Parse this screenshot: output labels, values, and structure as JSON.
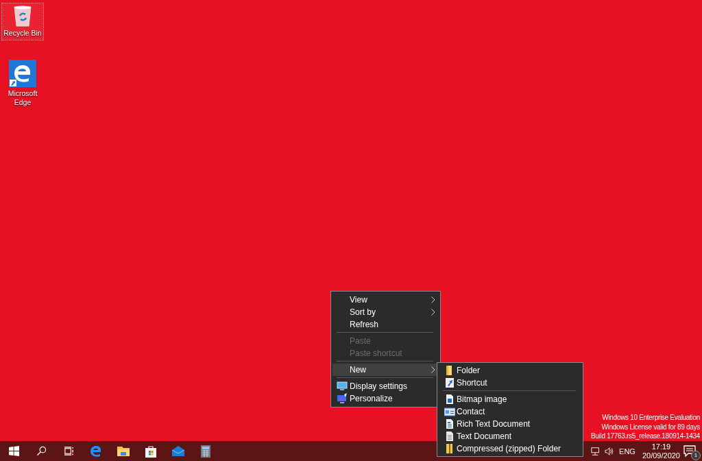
{
  "desktop_icons": [
    {
      "label": "Recycle Bin",
      "selected": true
    },
    {
      "label": "Microsoft Edge",
      "selected": false
    }
  ],
  "context_menu": {
    "items": [
      {
        "kind": "item",
        "label": "View",
        "submenu": true,
        "disabled": false,
        "selected": false
      },
      {
        "kind": "item",
        "label": "Sort by",
        "submenu": true,
        "disabled": false,
        "selected": false
      },
      {
        "kind": "item",
        "label": "Refresh",
        "submenu": false,
        "disabled": false,
        "selected": false
      },
      {
        "kind": "separator"
      },
      {
        "kind": "item",
        "label": "Paste",
        "submenu": false,
        "disabled": true,
        "selected": false
      },
      {
        "kind": "item",
        "label": "Paste shortcut",
        "submenu": false,
        "disabled": true,
        "selected": false
      },
      {
        "kind": "separator"
      },
      {
        "kind": "item",
        "label": "New",
        "submenu": true,
        "disabled": false,
        "selected": true
      },
      {
        "kind": "separator"
      },
      {
        "kind": "item",
        "label": "Display settings",
        "submenu": false,
        "disabled": false,
        "selected": false
      },
      {
        "kind": "item",
        "label": "Personalize",
        "submenu": false,
        "disabled": false,
        "selected": false
      }
    ]
  },
  "new_submenu": {
    "items": [
      {
        "kind": "item",
        "label": "Folder"
      },
      {
        "kind": "item",
        "label": "Shortcut"
      },
      {
        "kind": "separator"
      },
      {
        "kind": "item",
        "label": "Bitmap image"
      },
      {
        "kind": "item",
        "label": "Contact"
      },
      {
        "kind": "item",
        "label": "Rich Text Document"
      },
      {
        "kind": "item",
        "label": "Text Document"
      },
      {
        "kind": "item",
        "label": "Compressed (zipped) Folder"
      }
    ]
  },
  "activation_watermark": [
    "Windows 10 Enterprise Evaluation",
    "Windows License valid for 89 days",
    "Build 17763.rs5_release.180914-1434"
  ],
  "taskbar": {
    "buttons": [
      {
        "kind": "start"
      },
      {
        "kind": "search"
      },
      {
        "kind": "taskview"
      },
      {
        "kind": "edge"
      },
      {
        "kind": "explorer"
      },
      {
        "kind": "store"
      },
      {
        "kind": "mail"
      },
      {
        "kind": "calculator"
      }
    ],
    "language": "ENG",
    "time": "17:19",
    "date": "20/09/2020",
    "notification_count": "1"
  }
}
